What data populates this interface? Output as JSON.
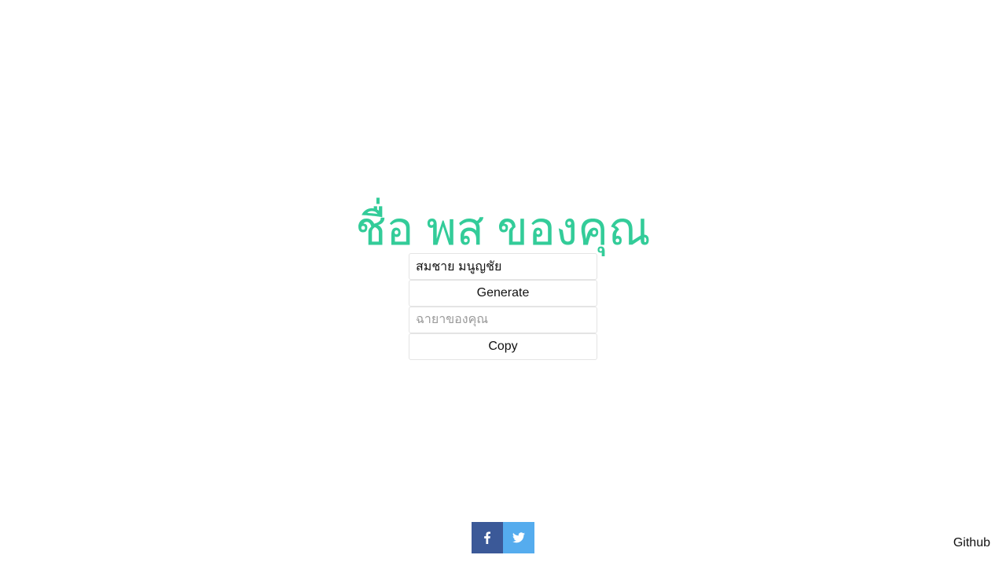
{
  "title": {
    "text": "ชื่อ พส ของคุณ",
    "color": "#33cc99"
  },
  "form": {
    "name_input_value": "สมชาย มนูญชัย",
    "generate_label": "Generate",
    "alias_placeholder": "ฉายาของคุณ",
    "alias_value": "",
    "copy_label": "Copy"
  },
  "share": {
    "facebook": {
      "icon": "facebook-icon",
      "color": "#3b5998"
    },
    "twitter": {
      "icon": "twitter-icon",
      "color": "#55acee"
    }
  },
  "footer": {
    "github_label": "Github"
  }
}
